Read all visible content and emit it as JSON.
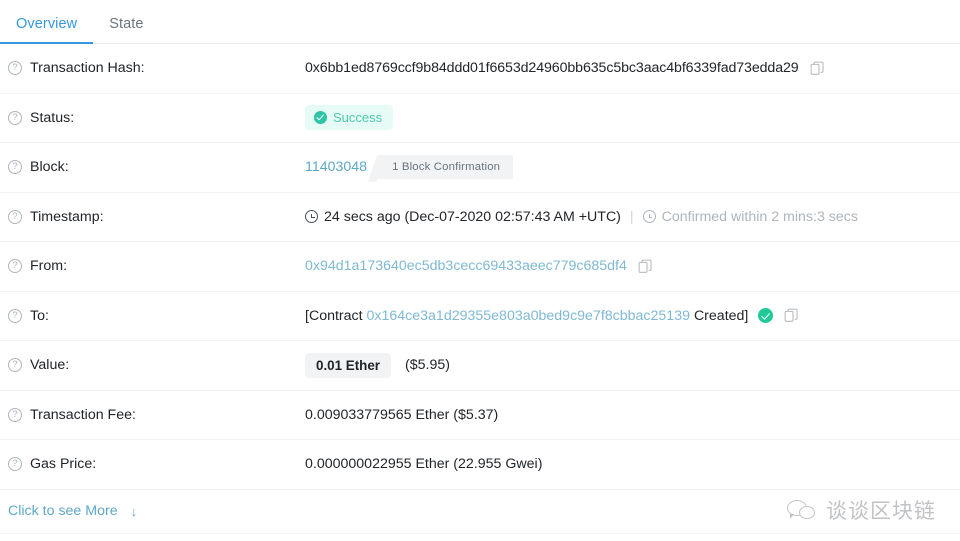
{
  "tabs": [
    {
      "label": "Overview",
      "active": true
    },
    {
      "label": "State",
      "active": false
    }
  ],
  "rows": {
    "transaction_hash": {
      "label": "Transaction Hash:",
      "value": "0x6bb1ed8769ccf9b84ddd01f6653d24960bb635c5bc3aac4bf6339fad73edda29",
      "copy_icon": "copy-icon"
    },
    "status": {
      "label": "Status:",
      "badge_text": "Success",
      "badge_icon": "check-circle-icon",
      "badge_bg": "#e6fbf5",
      "badge_color": "#4ec9ab"
    },
    "block": {
      "label": "Block:",
      "number": "11403048",
      "confirmation": "1 Block Confirmation"
    },
    "timestamp": {
      "label": "Timestamp:",
      "clock_icon": "clock-icon",
      "relative": "24 secs ago (Dec-07-2020 02:57:43 AM +UTC)",
      "separator": "|",
      "confirmed_icon": "clock-icon",
      "confirmed": "Confirmed within 2 mins:3 secs"
    },
    "from": {
      "label": "From:",
      "address": "0x94d1a173640ec5db3cecc69433aeec779c685df4",
      "copy_icon": "copy-icon"
    },
    "to": {
      "label": "To:",
      "prefix": "[Contract",
      "address": "0x164ce3a1d29355e803a0bed9c9e7f8cbbac25139",
      "suffix": "Created]",
      "verified_icon": "verified-check-icon",
      "copy_icon": "copy-icon"
    },
    "value": {
      "label": "Value:",
      "ether": "0.01 Ether",
      "usd": "($5.95)"
    },
    "transaction_fee": {
      "label": "Transaction Fee:",
      "value": "0.009033779565 Ether ($5.37)"
    },
    "gas_price": {
      "label": "Gas Price:",
      "value": "0.000000022955 Ether (22.955 Gwei)"
    }
  },
  "footer": {
    "more_label": "Click to see More",
    "more_arrow": "↓"
  },
  "watermark": {
    "text": "谈谈区块链",
    "icon": "wechat-icon"
  },
  "help_icon_glyph": "?",
  "colors": {
    "accent_blue": "#3498db",
    "link_blue": "#5da8c8",
    "success_green": "#2ec4a5",
    "muted_gray": "#adb5bd",
    "divider": "#f1f3f5"
  }
}
